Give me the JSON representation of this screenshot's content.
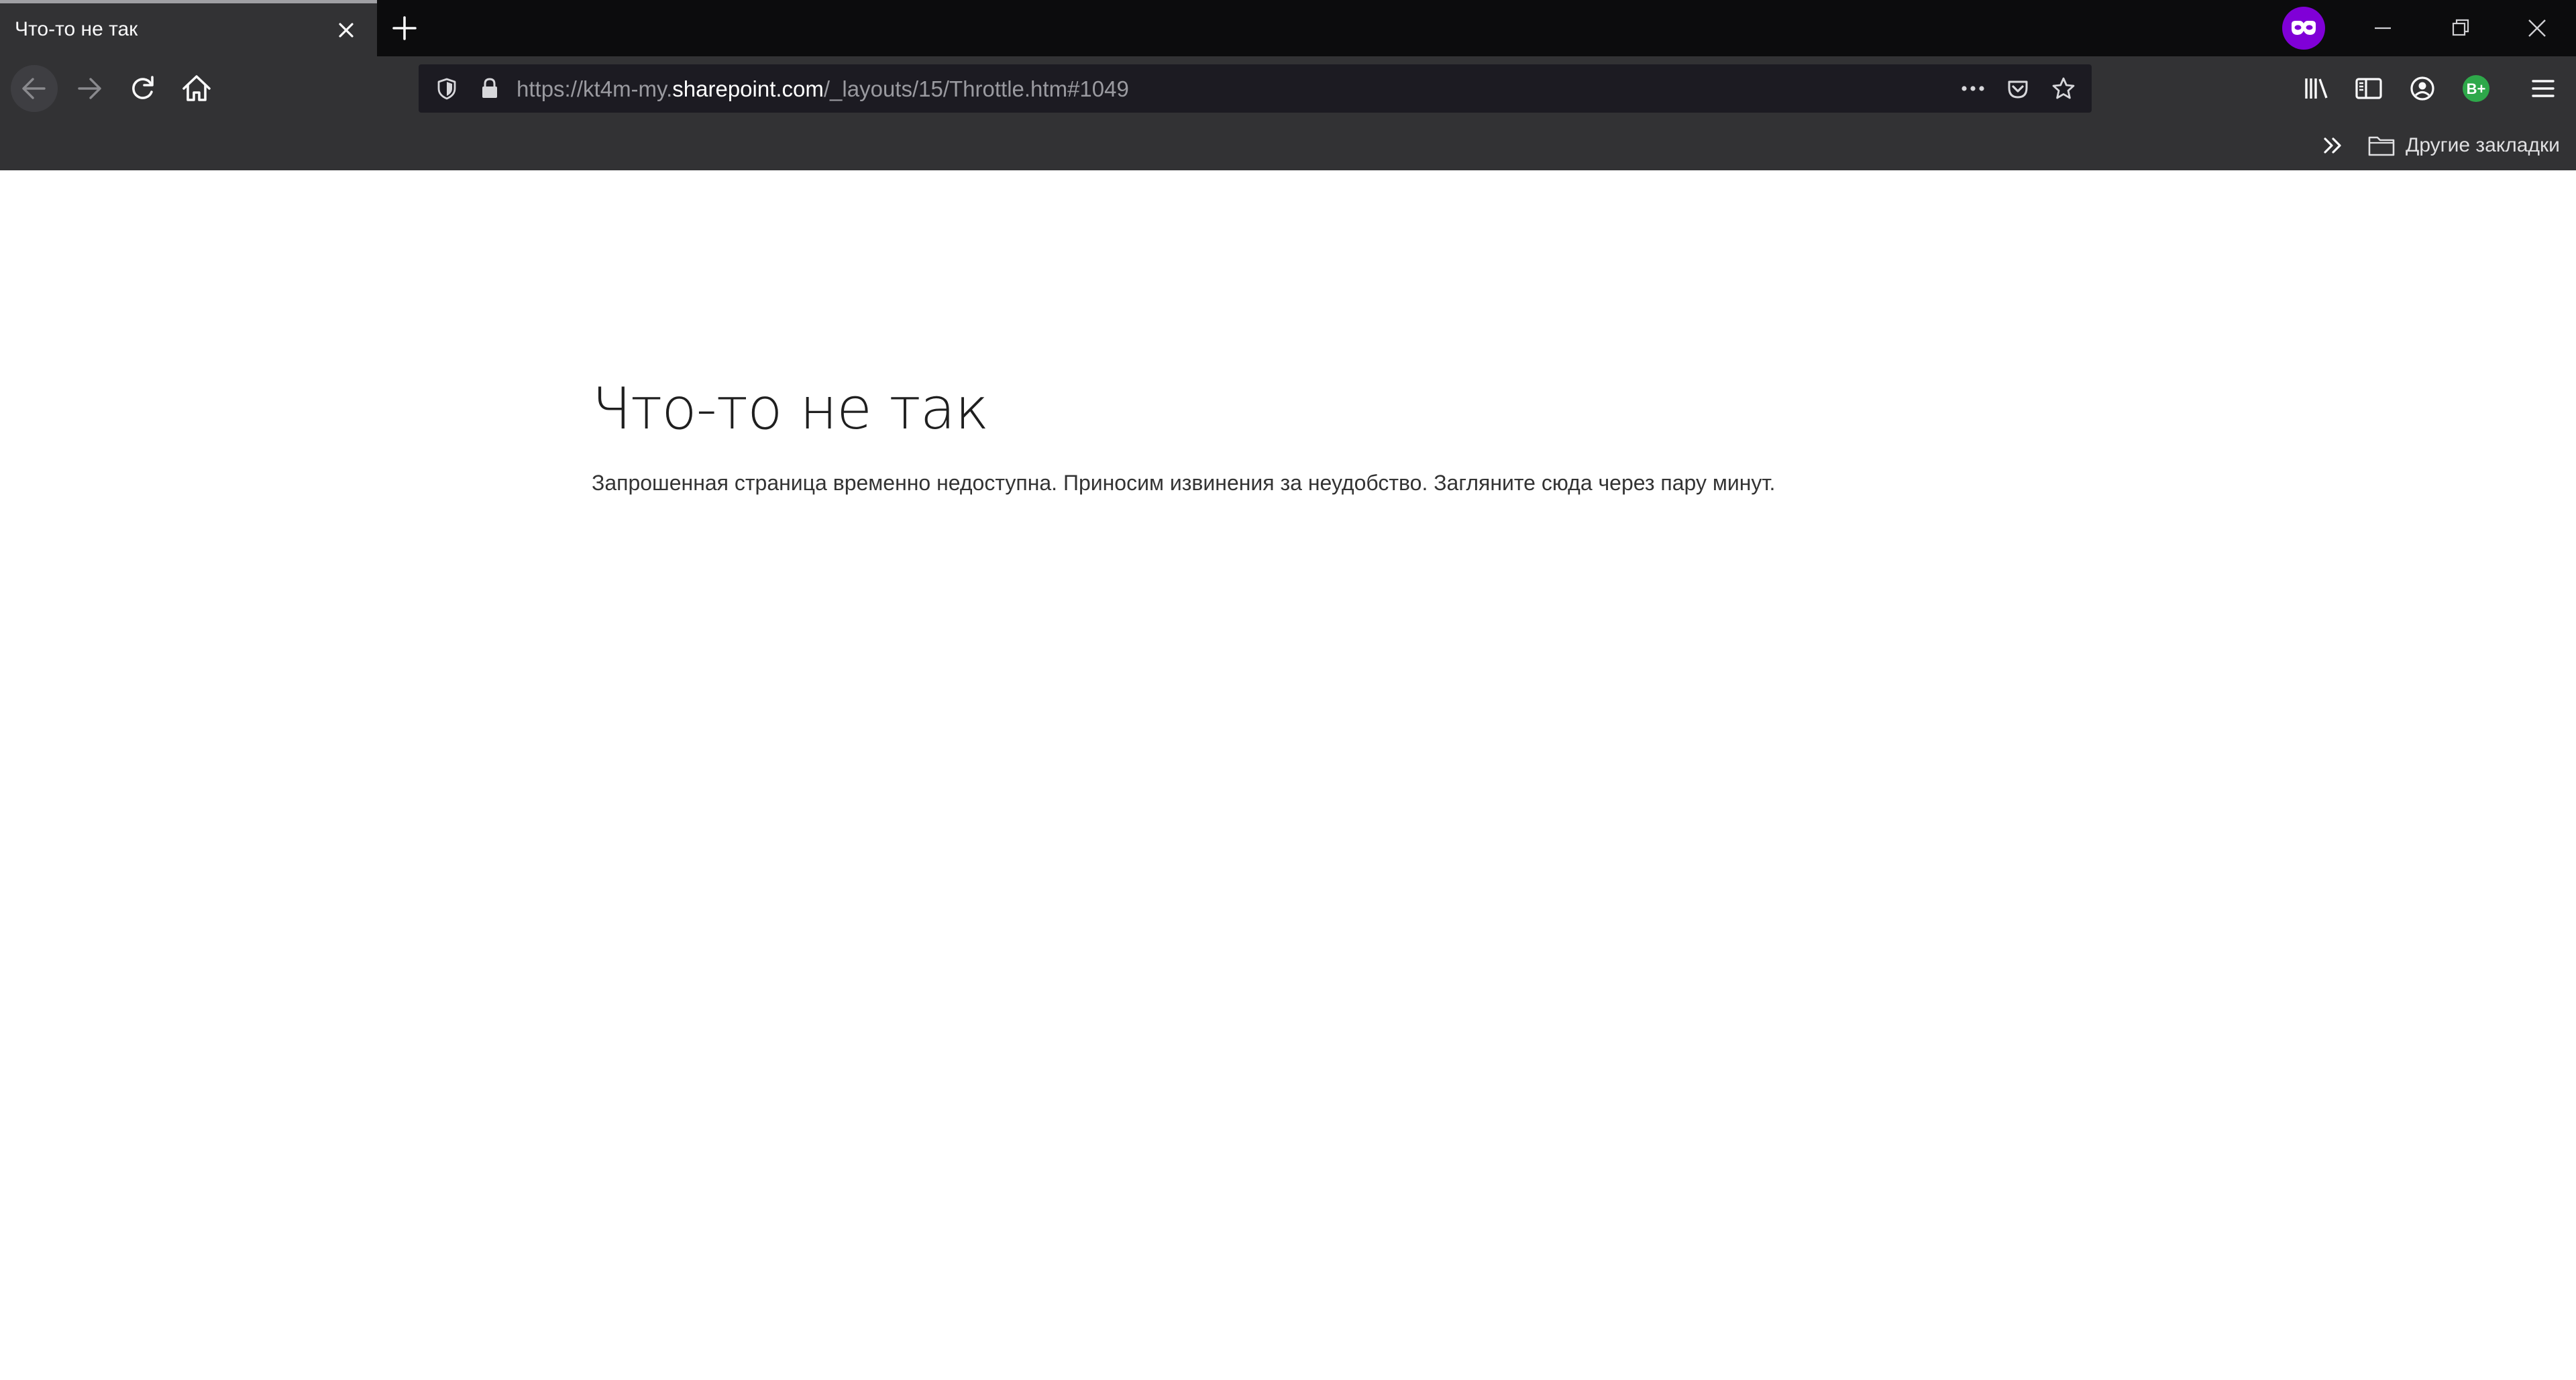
{
  "browser": {
    "tab": {
      "title": "Что-то не так"
    },
    "address_bar": {
      "url_prefix": "https://kt4m-my.",
      "url_domain": "sharepoint.com",
      "url_path": "/_layouts/15/Throttle.htm#1049"
    },
    "profile_badge": "B+",
    "bookmarks": {
      "other_bookmarks_label": "Другие закладки"
    },
    "icons": {
      "private_browsing": "private-mask-icon",
      "back": "arrow-left-icon",
      "forward": "arrow-right-icon",
      "reload": "reload-icon",
      "home": "home-icon",
      "tracking_protection": "shield-icon",
      "secure_connection": "lock-icon",
      "page_actions": "more-horizontal-icon",
      "pocket": "pocket-icon",
      "bookmark_star": "star-icon",
      "library": "library-icon",
      "sidebar": "sidebar-icon",
      "account": "account-icon",
      "menu": "hamburger-menu-icon",
      "overflow": "chevron-double-right-icon",
      "folder": "folder-icon"
    },
    "colors": {
      "private_accent": "#8000d7",
      "extension_badge": "#2ea84a"
    }
  },
  "page": {
    "heading": "Что-то не так",
    "message": "Запрошенная страница временно недоступна. Приносим извинения за неудобство. Загляните сюда через пару минут."
  }
}
